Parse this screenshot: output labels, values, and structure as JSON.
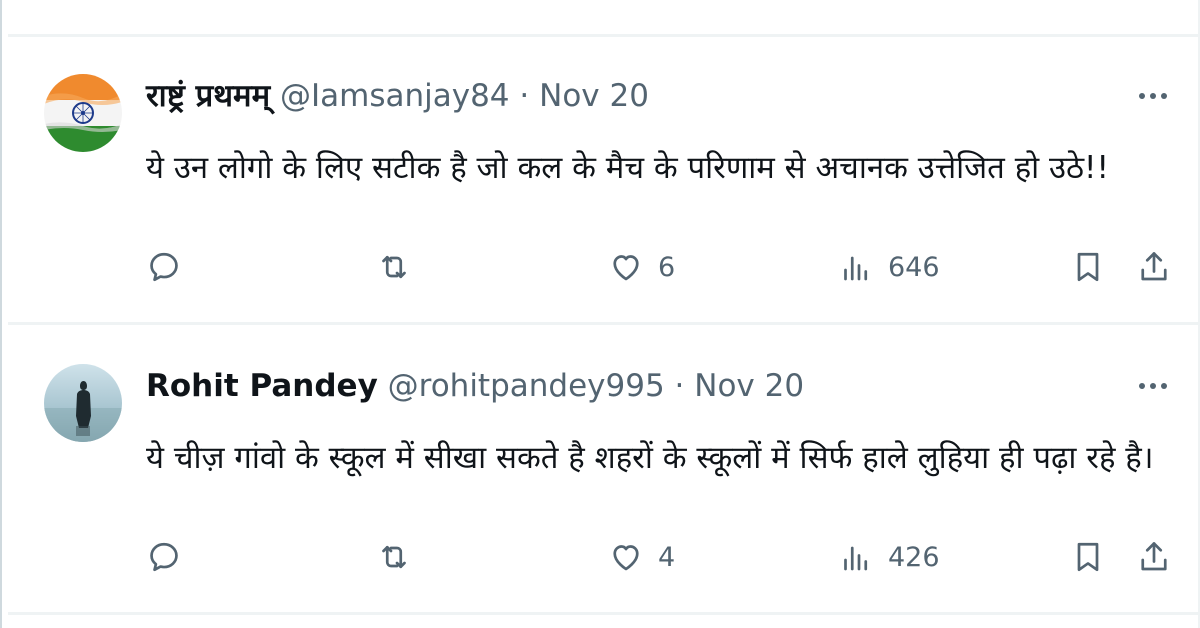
{
  "tweets": [
    {
      "author_name": "राष्ट्रं प्रथमम्",
      "handle": "@Iamsanjay84",
      "separator": "·",
      "time": "Nov 20",
      "text": "ये उन लोगो के लिए सटीक है जो कल के मैच के परिणाम से अचानक उत्तेजित हो उठे!!",
      "avatar_icon": "india-flag-avatar",
      "likes": "6",
      "views": "646"
    },
    {
      "author_name": "Rohit Pandey",
      "handle": "@rohitpandey995",
      "separator": "·",
      "time": "Nov 20",
      "text": "ये चीज़ गांवो के स्कूल में सीखा सकते है शहरों के स्कूलों में सिर्फ हाले लुहिया ही पढ़ा रहे है।",
      "avatar_icon": "silhouette-avatar",
      "likes": "4",
      "views": "426"
    }
  ],
  "icons": {
    "reply": "reply-icon",
    "retweet": "retweet-icon",
    "like": "heart-icon",
    "views": "views-icon",
    "bookmark": "bookmark-icon",
    "share": "share-icon",
    "more": "more-icon"
  },
  "colors": {
    "text": "#0f1419",
    "secondary": "#536471",
    "divider": "#eff3f4"
  }
}
